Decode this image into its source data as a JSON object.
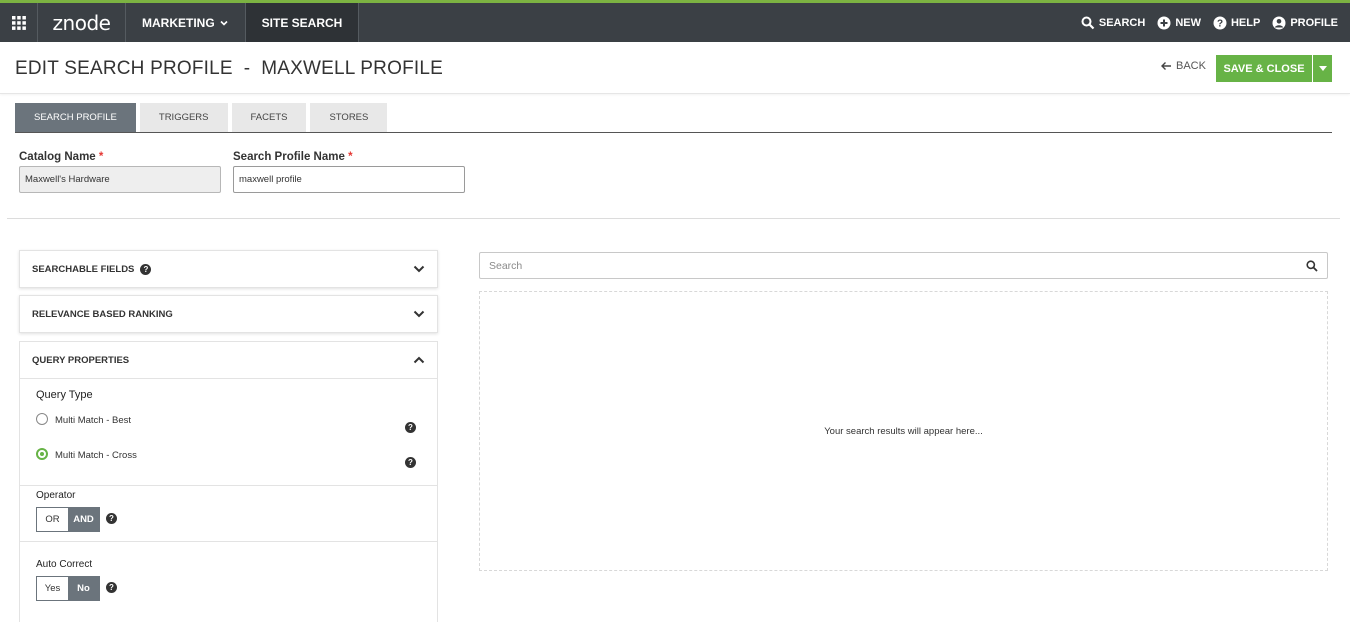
{
  "topnav": {
    "logo": "znode",
    "menu": [
      {
        "label": "MARKETING"
      },
      {
        "label": "SITE SEARCH"
      }
    ],
    "right": [
      {
        "label": "SEARCH",
        "icon": "search-icon"
      },
      {
        "label": "NEW",
        "icon": "plus-circle-icon"
      },
      {
        "label": "HELP",
        "icon": "help-circle-icon"
      },
      {
        "label": "PROFILE",
        "icon": "user-circle-icon"
      }
    ]
  },
  "header": {
    "title": "EDIT SEARCH PROFILE  -  MAXWELL PROFILE",
    "back_label": "BACK",
    "save_label": "SAVE & CLOSE"
  },
  "tabs": [
    {
      "label": "SEARCH PROFILE",
      "active": true
    },
    {
      "label": "TRIGGERS"
    },
    {
      "label": "FACETS"
    },
    {
      "label": "STORES"
    }
  ],
  "form": {
    "catalog_label": "Catalog Name",
    "catalog_value": "Maxwell's Hardware",
    "profile_label": "Search Profile Name",
    "profile_value": "maxwell profile",
    "required_mark": "*"
  },
  "accordion": {
    "searchable_fields": "SEARCHABLE FIELDS",
    "relevance_ranking": "RELEVANCE BASED RANKING",
    "query_properties": "QUERY PROPERTIES"
  },
  "query": {
    "type_label": "Query Type",
    "options": [
      {
        "label": "Multi Match - Best",
        "selected": false
      },
      {
        "label": "Multi Match - Cross",
        "selected": true
      }
    ],
    "operator_label": "Operator",
    "operator_options": [
      "OR",
      "AND"
    ],
    "operator_selected": "AND",
    "autocorrect_label": "Auto Correct",
    "autocorrect_options": [
      "Yes",
      "No"
    ],
    "autocorrect_selected": "No"
  },
  "results": {
    "search_placeholder": "Search",
    "empty_text": "Your search results will appear here..."
  },
  "colors": {
    "topbar": "#3b4045",
    "accent_green": "#67b346",
    "tab_active": "#6b747c",
    "required": "#e53935"
  }
}
